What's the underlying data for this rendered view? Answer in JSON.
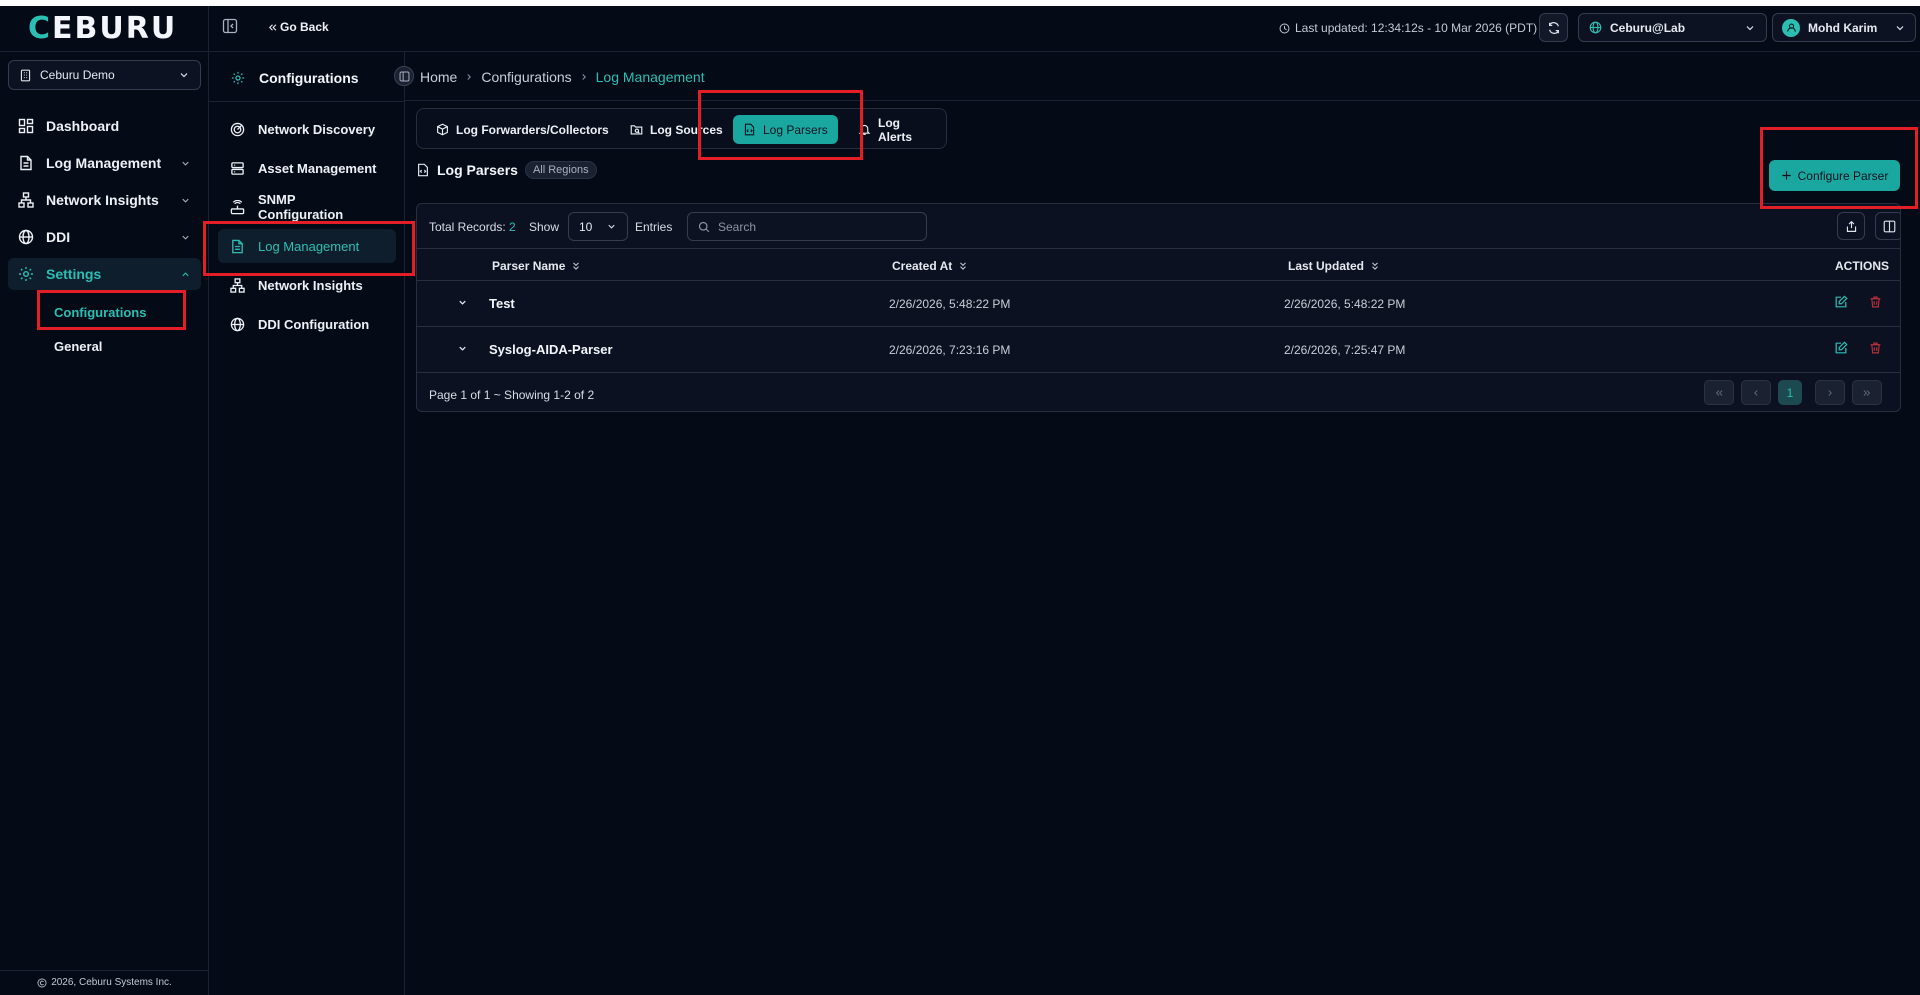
{
  "app": {
    "logo_text": "CEBURU"
  },
  "org_selector": {
    "value": "Ceburu Demo"
  },
  "sidebar": {
    "items": [
      {
        "label": "Dashboard",
        "icon": "dashboard-icon"
      },
      {
        "label": "Log Management",
        "icon": "document-icon",
        "expandable": true
      },
      {
        "label": "Network Insights",
        "icon": "network-icon",
        "expandable": true
      },
      {
        "label": "DDI",
        "icon": "globe-icon",
        "expandable": true
      },
      {
        "label": "Settings",
        "icon": "gear-icon",
        "expanded": true,
        "active": true
      }
    ],
    "subitems": [
      {
        "label": "Configurations",
        "active": true
      },
      {
        "label": "General"
      }
    ],
    "copyright": "2026, Ceburu Systems Inc."
  },
  "topbar": {
    "go_back": "Go Back",
    "last_updated": "Last updated: 12:34:12s - 10 Mar 2026 (PDT)",
    "tenant": "Ceburu@Lab",
    "user": "Mohd Karim"
  },
  "config_panel": {
    "title": "Configurations",
    "items": [
      {
        "label": "Network Discovery"
      },
      {
        "label": "Asset Management"
      },
      {
        "label": "SNMP Configuration"
      },
      {
        "label": "Log Management",
        "active": true
      },
      {
        "label": "Network Insights"
      },
      {
        "label": "DDI Configuration"
      }
    ]
  },
  "breadcrumb": [
    "Home",
    "Configurations",
    "Log Management"
  ],
  "tabs": [
    {
      "label": "Log Forwarders/Collectors"
    },
    {
      "label": "Log Sources"
    },
    {
      "label": "Log Parsers",
      "active": true
    },
    {
      "label": "Log Alerts"
    }
  ],
  "section": {
    "title": "Log Parsers",
    "badge": "All Regions",
    "configure_button": "Configure Parser"
  },
  "table": {
    "total_label": "Total Records:",
    "total_value": "2",
    "show_label": "Show",
    "page_size": "10",
    "entries_label": "Entries",
    "search_placeholder": "Search",
    "columns": [
      "Parser Name",
      "Created At",
      "Last Updated",
      "ACTIONS"
    ],
    "rows": [
      {
        "name": "Test",
        "created": "2/26/2026, 5:48:22 PM",
        "updated": "2/26/2026, 5:48:22 PM"
      },
      {
        "name": "Syslog-AIDA-Parser",
        "created": "2/26/2026, 7:23:16 PM",
        "updated": "2/26/2026, 7:25:47 PM"
      }
    ],
    "footer": "Page 1 of 1 ~ Showing 1-2 of 2",
    "current_page": "1"
  },
  "colors": {
    "accent": "#19a7a0",
    "background": "#050a17",
    "danger": "#b8313a",
    "highlight": "#e41e26"
  }
}
